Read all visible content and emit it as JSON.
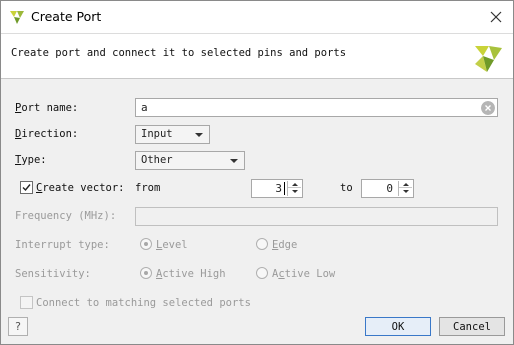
{
  "window": {
    "title": "Create Port"
  },
  "header": {
    "description": "Create port and connect it to selected pins and ports"
  },
  "form": {
    "port_name": {
      "label": "Port name:",
      "value": "a"
    },
    "direction": {
      "label": "Direction:",
      "value": "Input"
    },
    "type": {
      "label": "Type:",
      "value": "Other"
    },
    "create_vector": {
      "label": "Create vector:",
      "checked": true,
      "from_label": "from",
      "from_value": "3",
      "to_label": "to",
      "to_value": "0"
    },
    "frequency": {
      "label": "Frequency (MHz):",
      "value": ""
    },
    "interrupt_type": {
      "label": "Interrupt type:",
      "options": [
        "Level",
        "Edge"
      ],
      "selected": "Level"
    },
    "sensitivity": {
      "label": "Sensitivity:",
      "options": [
        "Active High",
        "Active Low"
      ],
      "selected": "Active High"
    },
    "connect_matching": {
      "label": "Connect to matching selected ports",
      "checked": false
    }
  },
  "buttons": {
    "ok": "OK",
    "cancel": "Cancel",
    "help": "?"
  },
  "colors": {
    "logo_yellow": "#c9d338",
    "logo_green": "#7a9e2e",
    "default_button_border": "#3a78c8"
  },
  "icons": {
    "app": "vivado-logo-icon",
    "close": "close-icon",
    "clear": "clear-input-icon",
    "help": "help-icon"
  }
}
